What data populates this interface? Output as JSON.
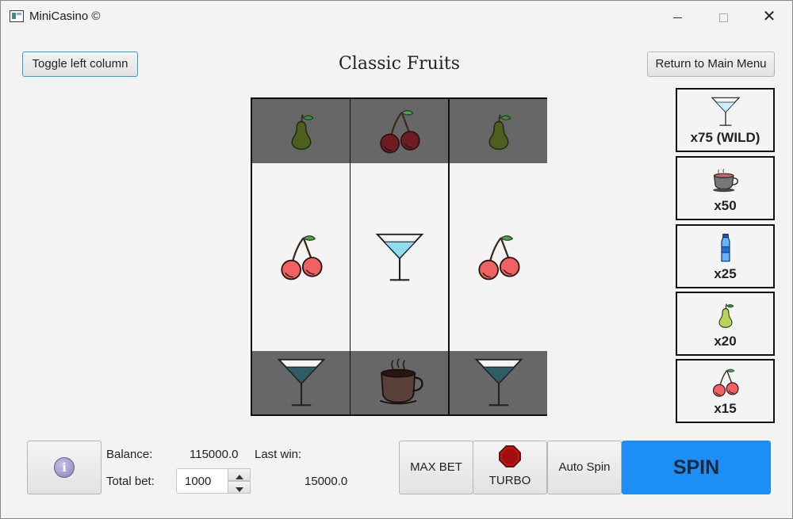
{
  "window": {
    "title": "MiniCasino ©",
    "controls": {
      "minimize": "minimize",
      "maximize": "maximize",
      "close": "✕"
    }
  },
  "header": {
    "toggle_label": "Toggle left column",
    "game_title": "Classic Fruits",
    "main_menu_label": "Return to Main Menu"
  },
  "reels": [
    [
      "pear",
      "cherry",
      "martini"
    ],
    [
      "cherry",
      "martini",
      "coffee"
    ],
    [
      "pear",
      "cherry",
      "martini"
    ]
  ],
  "paytable": [
    {
      "icon": "martini-icon",
      "label": "x75 (WILD)"
    },
    {
      "icon": "tea-cup-icon",
      "label": "x50"
    },
    {
      "icon": "water-bottle-icon",
      "label": "x25"
    },
    {
      "icon": "pear-icon",
      "label": "x20"
    },
    {
      "icon": "cherry-icon",
      "label": "x15"
    }
  ],
  "footer": {
    "balance_label": "Balance:",
    "balance_value": "115000.0",
    "last_win_label": "Last win:",
    "last_win_value": "15000.0",
    "total_bet_label": "Total bet:",
    "total_bet_value": "1000",
    "info_glyph": "i",
    "max_bet_label": "MAX BET",
    "turbo_label": "TURBO",
    "auto_spin_label": "Auto Spin",
    "spin_label": "SPIN"
  },
  "colors": {
    "spin_button": "#1e8ef7",
    "reel_dim": "#676767",
    "turbo_stop": "#c01515"
  }
}
